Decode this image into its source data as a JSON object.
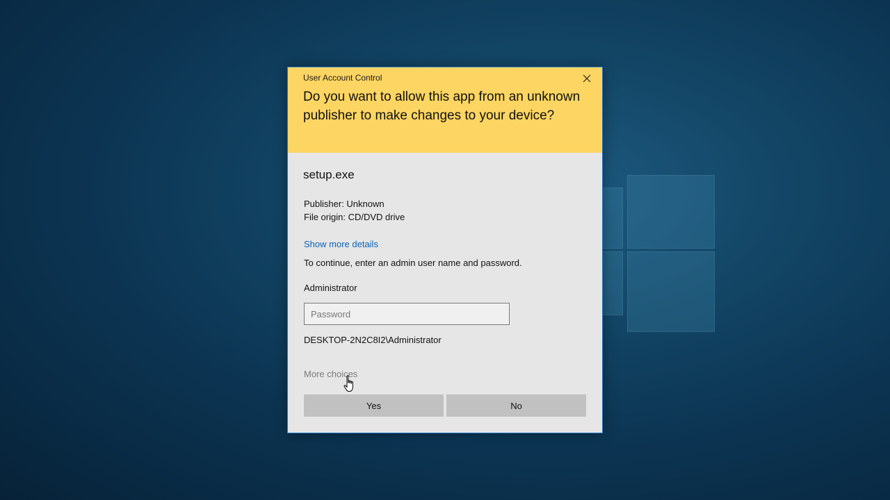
{
  "dialog": {
    "title": "User Account Control",
    "question": "Do you want to allow this app from an unknown publisher to make changes to your device?",
    "app_name": "setup.exe",
    "publisher": "Publisher: Unknown",
    "file_origin": "File origin: CD/DVD drive",
    "details_link": "Show more details",
    "instructions": "To continue, enter an admin user name and password.",
    "user_name": "Administrator",
    "password_placeholder": "Password",
    "password_value": "",
    "domain_user": "DESKTOP-2N2C8I2\\Administrator",
    "more_choices": "More choices",
    "yes_label": "Yes",
    "no_label": "No"
  },
  "colors": {
    "header": "#fdd562",
    "body": "#e6e6e6",
    "link": "#0a63b5",
    "button": "#c1c1c1",
    "border": "#2b79c9"
  },
  "icons": [
    "close-icon",
    "hand-cursor-icon",
    "windows-logo"
  ]
}
